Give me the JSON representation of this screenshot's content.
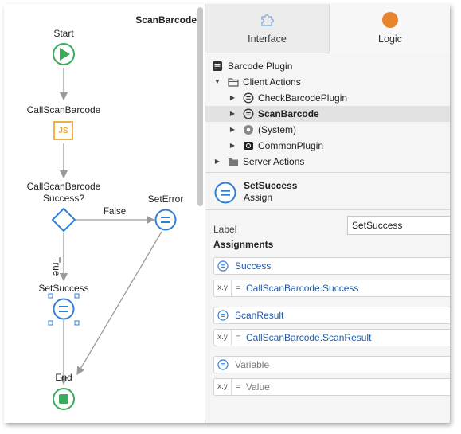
{
  "flow": {
    "title": "ScanBarcode",
    "nodes": {
      "start": "Start",
      "call": "CallScanBarcode",
      "decision_line1": "CallScanBarcode",
      "decision_line2": "Success?",
      "set_error": "SetError",
      "set_success": "SetSuccess",
      "end": "End"
    },
    "call_icon_text": "JS",
    "edges": {
      "false_label": "False",
      "true_label": "True"
    },
    "colors": {
      "start": "#3aaa5c",
      "js": "#f2a92b",
      "decision": "#2f7ed8",
      "assign": "#2f7ed8",
      "end": "#3aaa5c",
      "connector": "#9a9a9a"
    }
  },
  "tabs": [
    {
      "label": "Interface",
      "icon": "puzzle-icon"
    },
    {
      "label": "Logic",
      "icon": "logic-dot-icon"
    }
  ],
  "tree": [
    {
      "label": "Barcode Plugin",
      "icon": "plugin-module-icon"
    },
    {
      "label": "Client Actions",
      "icon": "folder-open-icon"
    },
    {
      "label": "CheckBarcodePlugin",
      "icon": "client-action-icon"
    },
    {
      "label": "ScanBarcode",
      "icon": "client-action-icon"
    },
    {
      "label": "(System)",
      "icon": "system-icon"
    },
    {
      "label": "CommonPlugin",
      "icon": "common-plugin-icon"
    },
    {
      "label": "Server Actions",
      "icon": "folder-icon"
    }
  ],
  "properties": {
    "title": "SetSuccess",
    "subtitle": "Assign",
    "label_caption": "Label",
    "label_value": "SetSuccess",
    "assignments_title": "Assignments"
  },
  "assignments": [
    {
      "variable": "Success",
      "value": "CallScanBarcode.Success"
    },
    {
      "variable": "ScanResult",
      "value": "CallScanBarcode.ScanResult"
    },
    {
      "variable": "Variable",
      "value": "Value"
    }
  ],
  "assignment_value_prefix": "x.y",
  "assignment_operator": "="
}
